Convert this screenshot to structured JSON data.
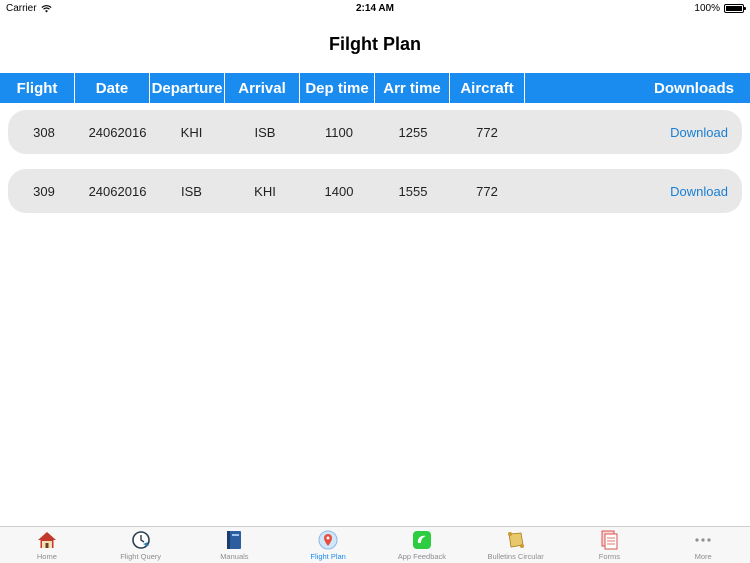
{
  "status_bar": {
    "carrier": "Carrier",
    "time": "2:14 AM",
    "battery": "100%"
  },
  "page": {
    "title": "Filght Plan"
  },
  "table": {
    "headers": [
      "Flight",
      "Date",
      "Departure",
      "Arrival",
      "Dep time",
      "Arr time",
      "Aircraft",
      "Downloads"
    ],
    "rows": [
      {
        "flight": "308",
        "date": "24062016",
        "departure": "KHI",
        "arrival": "ISB",
        "dep_time": "1100",
        "arr_time": "1255",
        "aircraft": "772",
        "download": "Download"
      },
      {
        "flight": "309",
        "date": "24062016",
        "departure": "ISB",
        "arrival": "KHI",
        "dep_time": "1400",
        "arr_time": "1555",
        "aircraft": "772",
        "download": "Download"
      }
    ]
  },
  "tab_bar": {
    "items": [
      {
        "label": "Home",
        "icon": "home-icon"
      },
      {
        "label": "Flight Query",
        "icon": "clock-plane-icon"
      },
      {
        "label": "Manuals",
        "icon": "book-icon"
      },
      {
        "label": "Flight Plan",
        "icon": "map-pin-icon"
      },
      {
        "label": "App Feedback",
        "icon": "feedback-icon"
      },
      {
        "label": "Bulletins Circular",
        "icon": "scroll-icon"
      },
      {
        "label": "Forms",
        "icon": "forms-icon"
      },
      {
        "label": "More",
        "icon": "more-icon"
      }
    ]
  },
  "colors": {
    "accent": "#1a8cf0",
    "row_bg": "#e8e8e8",
    "link": "#1a7fd4"
  }
}
